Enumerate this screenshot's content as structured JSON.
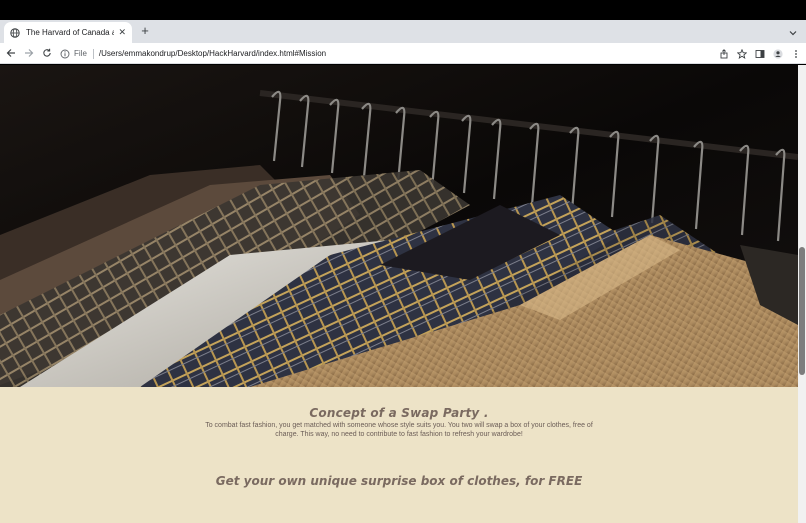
{
  "browser": {
    "tab_title": "The Harvard of Canada at Ha",
    "url_scheme": "File",
    "url": "/Users/emmakondrup/Desktop/HackHarvard/index.html#Mission",
    "icons": [
      "globe-icon",
      "close-icon",
      "plus-icon",
      "back-icon",
      "forward-icon",
      "reload-icon",
      "info-icon",
      "share-icon",
      "star-icon",
      "sidepanel-icon",
      "profile-icon",
      "menu-icon"
    ]
  },
  "page": {
    "concept_heading": "Concept of a Swap Party .",
    "concept_text": "To combat fast fashion, you get matched with someone whose style suits you. You two will swap a box of your clothes, free of charge. This way, no need to contribute to fast fashion to refresh your wardrobe!",
    "free_heading": "Get your own unique surprise box of clothes, for FREE"
  },
  "colors": {
    "page_bg": "#ede3c7",
    "heading": "#7a6a60",
    "body_text": "#6b5d57"
  }
}
